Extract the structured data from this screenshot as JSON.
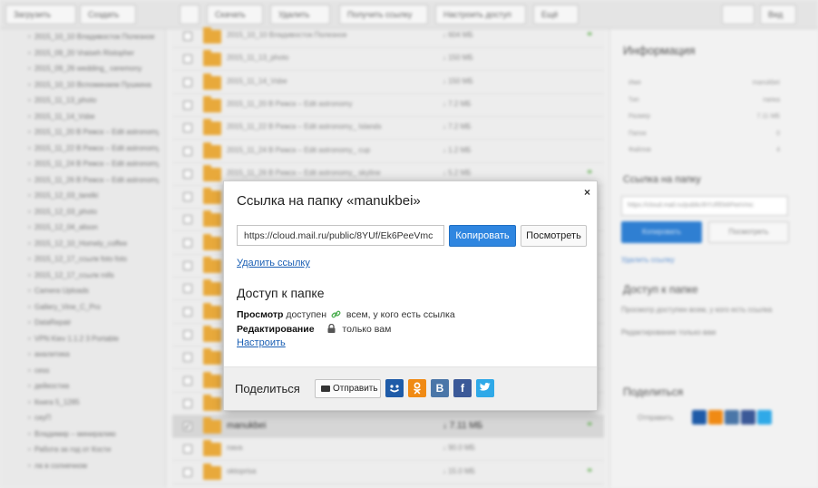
{
  "background": {
    "toolbar_left": [
      "Загрузить",
      "Создать"
    ],
    "toolbar_mid": [
      "Скачать",
      "Удалить",
      "Получить ссылку",
      "Настроить доступ",
      "Ещё"
    ],
    "toolbar_right": [
      "Вид"
    ],
    "files": [
      {
        "name": "2015_10_10 Владивосток Полезное",
        "size": "↓ 604 МБ",
        "shared": true
      },
      {
        "name": "2015_11_13_photo",
        "size": "↓ 150 МБ",
        "shared": false
      },
      {
        "name": "2015_11_14_Vsbe",
        "size": "↓ 150 МБ",
        "shared": false
      },
      {
        "name": "2015_11_20 В Рижск – Edit astronomy",
        "size": "↓ 7.2 МБ",
        "shared": false
      },
      {
        "name": "2015_11_22 В Рижск – Edit astronomy_ Islands",
        "size": "↓ 7.2 МБ",
        "shared": false
      },
      {
        "name": "2015_11_24 В Рижск – Edit astronomy_ cup",
        "size": "↓ 1.2 МБ",
        "shared": false
      },
      {
        "name": "2015_11_26 В Рижск – Edit astronomy_ skyline",
        "size": "↓ 5.2 МБ",
        "shared": true
      },
      {
        "name": "",
        "size": "",
        "shared": false
      },
      {
        "name": "",
        "size": "",
        "shared": false
      },
      {
        "name": "",
        "size": "",
        "shared": false
      },
      {
        "name": "",
        "size": "",
        "shared": false
      },
      {
        "name": "",
        "size": "",
        "shared": false
      },
      {
        "name": "",
        "size": "",
        "shared": false
      },
      {
        "name": "",
        "size": "",
        "shared": false
      },
      {
        "name": "",
        "size": "",
        "shared": false
      },
      {
        "name": "",
        "size": "",
        "shared": false
      },
      {
        "name": "",
        "size": "",
        "shared": false
      },
      {
        "name": "manukbei",
        "size": "↓ 7.11 МБ",
        "shared": true,
        "selected": true
      },
      {
        "name": "nava",
        "size": "↓ 90.0 МБ",
        "shared": false
      },
      {
        "name": "oktoprisa",
        "size": "↓ 15.0 МБ",
        "shared": true
      }
    ],
    "tree": [
      "2015_10_10 Владивосток Полезное",
      "2015_09_20 Vraiseh Ristopher",
      "2015_09_26 wedding_ ceremony",
      "2015_10_10 Вспоминаем Пушкина",
      "2015_11_13_photo",
      "2015_11_14_Vsbe",
      "2015_11_20 В Рижск – Edit astronomy",
      "2015_11_22 В Рижск – Edit astronomy",
      "2015_11_24 В Рижск – Edit astronomy",
      "2015_11_26 В Рижск – Edit astronomy",
      "2015_12_03_tarelki",
      "2015_12_03_photo",
      "2015_12_04_alison",
      "2015_12_10_Homely_coffee",
      "2015_12_17_ссылк foto foto",
      "2015_12_17_ссылк rolls",
      "Camera Uploads",
      "Gallery_Vine_C_Pro",
      "DataRepair",
      "VPN Kiev 1.1.2 3 Portable",
      "аналитика",
      "сess",
      "дейкостиа",
      "Книга 5_1285",
      "сиуП",
      "Владимир – миниралию",
      "Работа за год от Кости",
      "ла в солнечном"
    ],
    "panel": {
      "info_title": "Информация",
      "info_rows": [
        [
          "Имя",
          "manukbei"
        ],
        [
          "Тип",
          "папка"
        ],
        [
          "Размер",
          "7.11 МБ"
        ],
        [
          "Папок",
          "0"
        ],
        [
          "Файлов",
          "4"
        ]
      ],
      "link_title": "Ссылка на папку",
      "link_value": "https://cloud.mail.ru/public/8YUf/Ek6PeeVmc",
      "copy": "Копировать",
      "view": "Посмотреть",
      "delete": "Удалить ссылку",
      "access_title": "Доступ к папке",
      "access_view": "Просмотр доступен всем, у кого есть ссылка",
      "access_edit": "Редактирование только вам",
      "share_title": "Поделиться",
      "send": "Отправить"
    }
  },
  "modal": {
    "title": "Ссылка на папку «manukbei»",
    "close": "×",
    "url": "https://cloud.mail.ru/public/8YUf/Ek6PeeVmc",
    "copy_label": "Копировать",
    "view_label": "Посмотреть",
    "delete_link": "Удалить ссылку",
    "access_title": "Доступ к папке",
    "view_label_bold": "Просмотр",
    "view_status": "доступен",
    "view_who": "всем, у кого есть ссылка",
    "edit_label_bold": "Редактирование",
    "edit_who": "только вам",
    "configure": "Настроить",
    "share_label": "Поделиться",
    "send_label": "Отправить",
    "colors": {
      "accent": "#2f86e0",
      "link": "#1a5fb4",
      "green": "#4caf50"
    },
    "socials": [
      {
        "name": "mail-agent",
        "color": "#1e5ba8"
      },
      {
        "name": "odnoklassniki",
        "color": "#f08a14"
      },
      {
        "name": "vkontakte",
        "color": "#4a76a8",
        "glyph": "В"
      },
      {
        "name": "facebook",
        "color": "#3b5998",
        "glyph": "f"
      },
      {
        "name": "twitter",
        "color": "#2fa9e8"
      }
    ]
  }
}
